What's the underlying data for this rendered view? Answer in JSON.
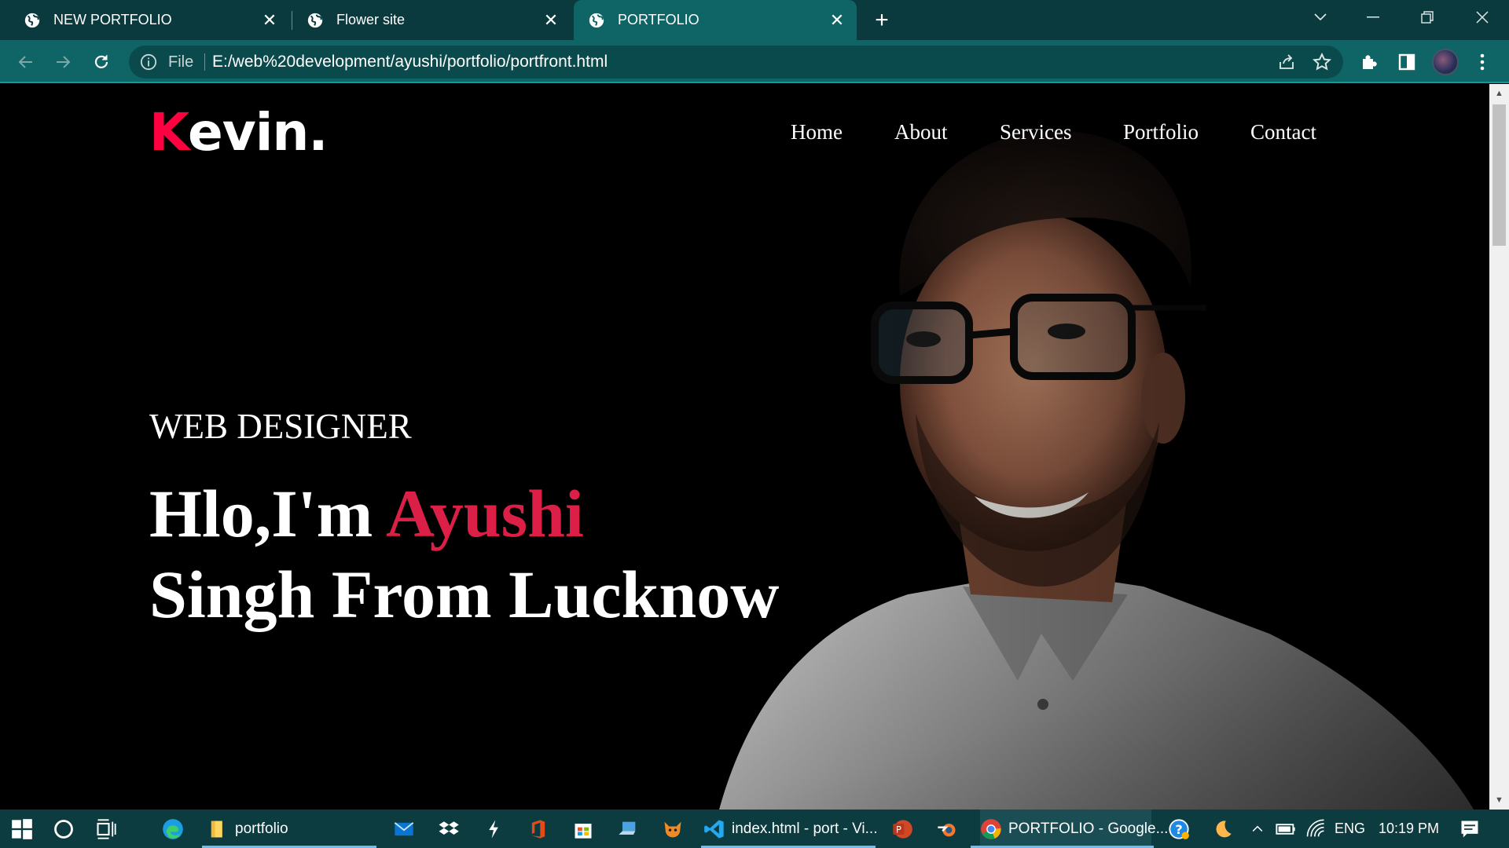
{
  "browser": {
    "tabs": [
      {
        "title": "NEW PORTFOLIO",
        "active": false
      },
      {
        "title": "Flower site",
        "active": false
      },
      {
        "title": "PORTFOLIO",
        "active": true
      }
    ],
    "omnibox": {
      "scheme_label": "File",
      "url": "E:/web%20development/ayushi/portfolio/portfront.html"
    }
  },
  "page": {
    "logo": {
      "first_letter": "K",
      "rest": "evin."
    },
    "nav": [
      "Home",
      "About",
      "Services",
      "Portfolio",
      "Contact"
    ],
    "subtitle": "WEB DESIGNER",
    "headline": {
      "prefix": "Hlo,I'm ",
      "name": "Ayushi",
      "line2": "Singh From Lucknow"
    },
    "colors": {
      "accent": "#dc1f46",
      "logo_accent": "#ff0040",
      "background": "#000000"
    }
  },
  "taskbar": {
    "items": [
      {
        "label": "portfolio",
        "icon": "file-explorer-icon"
      },
      {
        "label": "index.html - port - Vi...",
        "icon": "vscode-icon"
      },
      {
        "label": "PORTFOLIO - Google...",
        "icon": "chrome-icon"
      }
    ],
    "language": "ENG",
    "time": "10:19 PM"
  }
}
